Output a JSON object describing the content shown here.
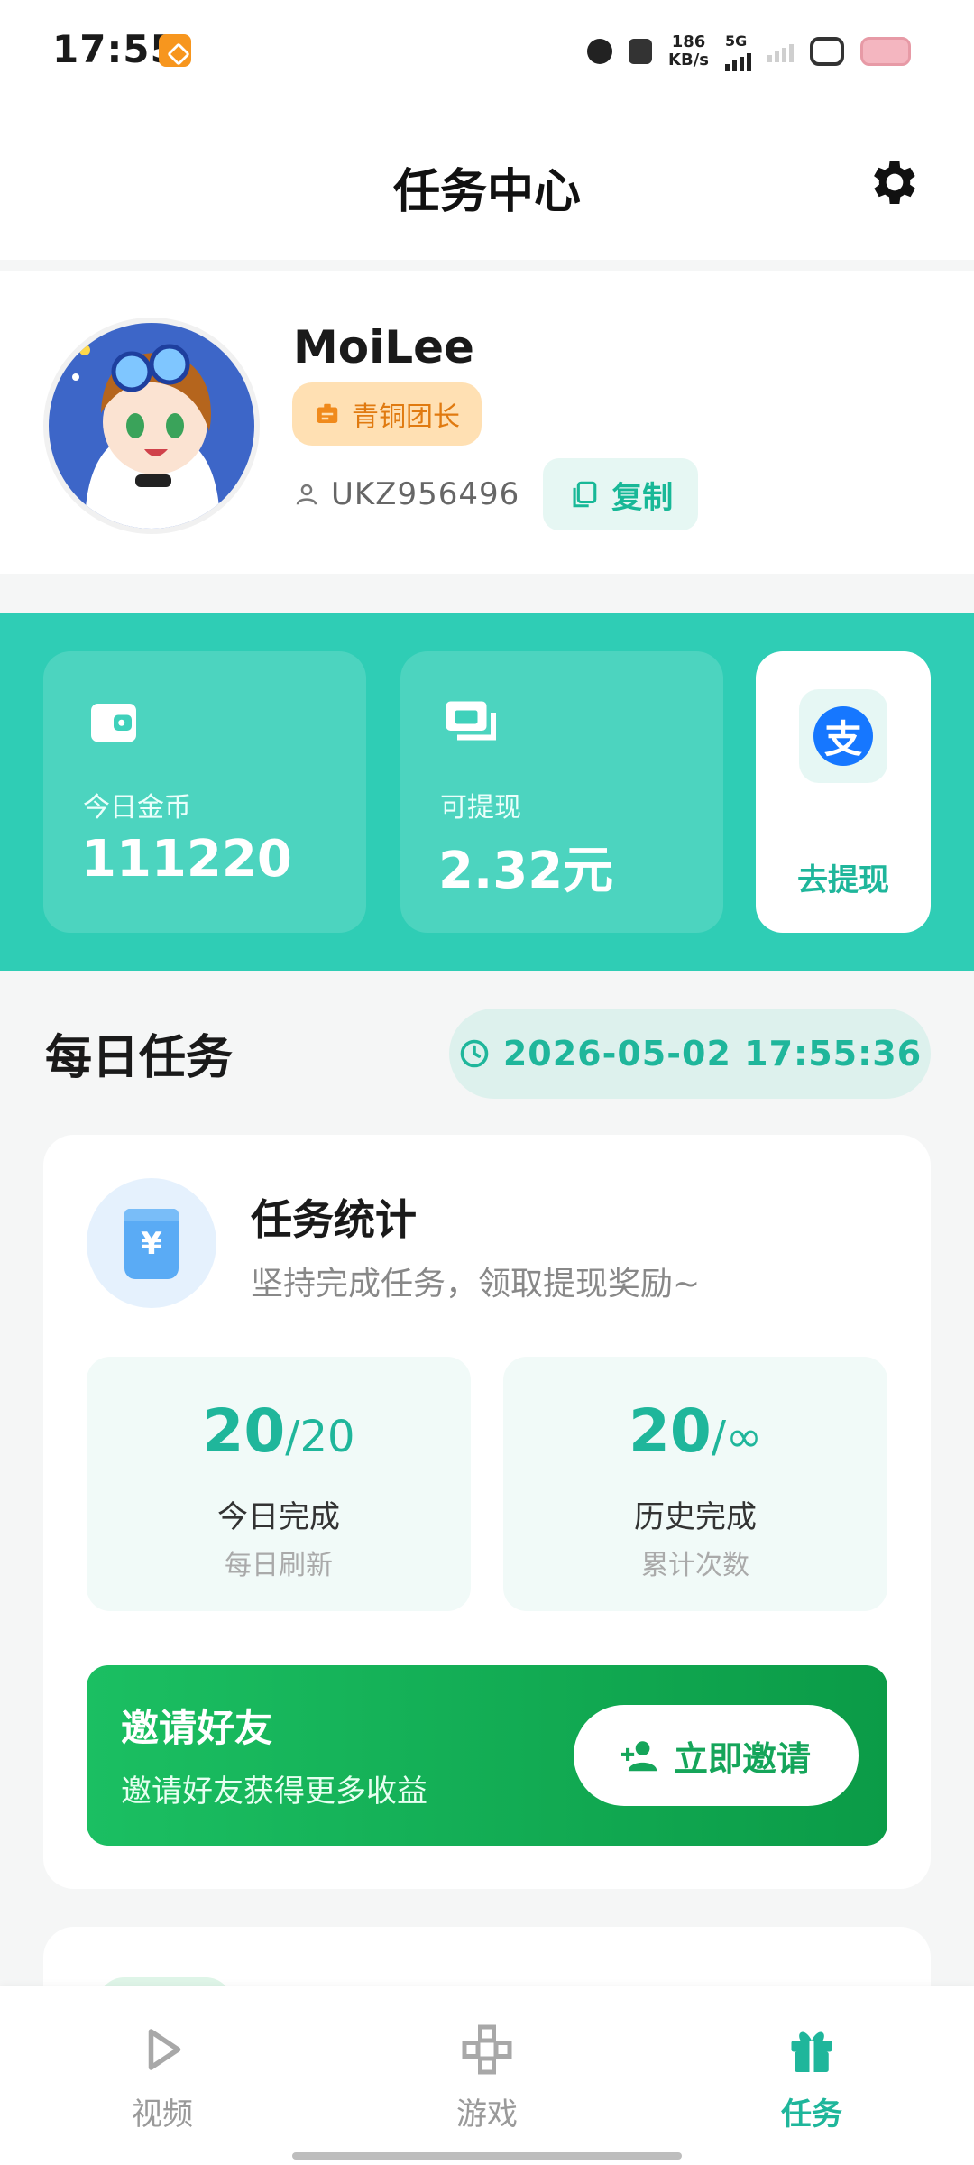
{
  "status_bar": {
    "time": "17:55",
    "net_speed_value": "186",
    "net_speed_unit": "KB/s",
    "network": "5G"
  },
  "header": {
    "title": "任务中心"
  },
  "profile": {
    "username": "MoiLee",
    "level": "青铜团长",
    "uid": "UKZ956496",
    "copy_label": "复制"
  },
  "stats": {
    "coins_label": "今日金币",
    "coins_value": "111220",
    "withdrawable_label": "可提现",
    "withdrawable_value": "2.32元",
    "withdraw_label": "去提现",
    "alipay_glyph": "支"
  },
  "daily": {
    "title": "每日任务",
    "datetime": "2026-05-02 17:55:36",
    "card_title": "任务统计",
    "card_subtitle": "坚持完成任务，领取提现奖励~",
    "yen_glyph": "¥",
    "today": {
      "done": "20",
      "total": "/20",
      "label": "今日完成",
      "hint": "每日刷新"
    },
    "history": {
      "done": "20",
      "total": "/∞",
      "label": "历史完成",
      "hint": "累计次数"
    },
    "invite": {
      "title": "邀请好友",
      "subtitle": "邀请好友获得更多收益",
      "button": "立即邀请"
    }
  },
  "nav": {
    "items": [
      {
        "label": "视频"
      },
      {
        "label": "游戏"
      },
      {
        "label": "任务"
      }
    ]
  },
  "colors": {
    "accent": "#1fb69b",
    "stats_band": "#2fcdb5",
    "invite_green": "#13ad55",
    "badge_bg": "#ffe0b3"
  }
}
